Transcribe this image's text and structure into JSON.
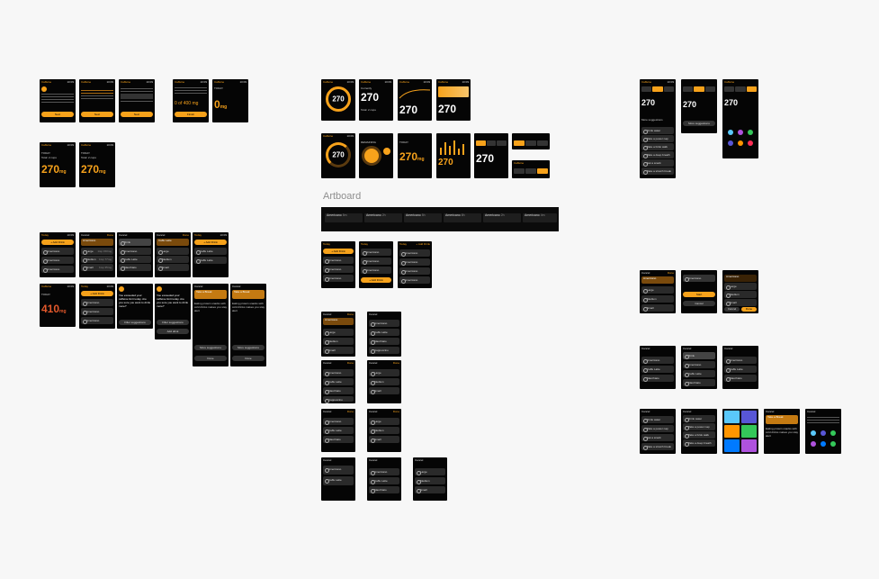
{
  "artboard": {
    "title": "Artboard"
  },
  "app": {
    "name": "Caffeine",
    "time": "10:09",
    "today": "TODAY",
    "currently": "Currently"
  },
  "intake": {
    "value": "270",
    "unit": "mg",
    "zero": "0",
    "over": "410",
    "sub": "Total: 2 cups",
    "remaining_label": "REMAINING",
    "caffeine_low": "0 of 400 mg"
  },
  "buttons": {
    "next": "Next",
    "finish": "Finish",
    "add_drink": "+ Add Drink",
    "add_drink_plain": "Add drink",
    "filter": "Filter suggestions",
    "more": "More suggestions",
    "done": "Done",
    "cancel": "Cancel",
    "start": "Start"
  },
  "drinks": {
    "americano": "Americano",
    "latte": "Caffe Latte",
    "macchiato": "Macchiato",
    "cappuccino": "Cappuccino",
    "espresso": "Espresso",
    "drink": "Drink",
    "today_label": "Today"
  },
  "sizes": {
    "large": "Large",
    "medium": "Medium",
    "small": "Small",
    "large_mg": "1tsp 150mg",
    "medium_mg": "1tsp 77mg",
    "small_mg": "1tsp 35mg"
  },
  "warnings": {
    "exceeded": "You exceeded your caffeine limit today. Are you sure you want to drink more?",
    "break": "Take a Break",
    "break_body": "Eating protein snacks with cold drinks makes you stay alert"
  },
  "suggestions": [
    "Drink water",
    "Take a power nap",
    "Take a brisk walk",
    "Take a deep breath",
    "Eat a snack",
    "Take a stretch break"
  ],
  "strip_items": [
    {
      "title": "Americano",
      "detail": "5m"
    },
    {
      "title": "Americano",
      "detail": "2h"
    },
    {
      "title": "Americano",
      "detail": "5h"
    },
    {
      "title": "Americano",
      "detail": "8h"
    },
    {
      "title": "Americano",
      "detail": "2h"
    },
    {
      "title": "Americano",
      "detail": "4m"
    }
  ],
  "colors": {
    "accent": "#f7a21b",
    "watch_bg": "#050505",
    "canvas": "#f7f7f7",
    "label": "#8e8e8e"
  }
}
